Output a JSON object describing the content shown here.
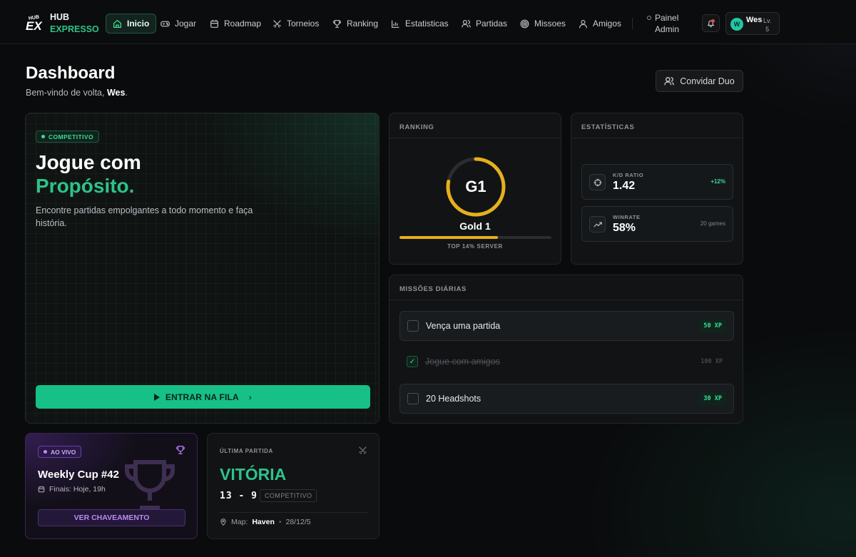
{
  "brand": {
    "line1": "HUB",
    "line2": "EXPRESSO",
    "logo_text": "EX"
  },
  "nav": {
    "items": [
      {
        "label": "Inicio",
        "icon": "home-icon",
        "active": true
      },
      {
        "label": "Jogar",
        "icon": "gamepad-icon"
      },
      {
        "label": "Roadmap",
        "icon": "calendar-icon"
      },
      {
        "label": "Torneios",
        "icon": "swords-icon"
      },
      {
        "label": "Ranking",
        "icon": "trophy-icon"
      },
      {
        "label": "Estatisticas",
        "icon": "bar-chart-icon"
      },
      {
        "label": "Partidas",
        "icon": "users-icon"
      },
      {
        "label": "Missoes",
        "icon": "target-icon"
      },
      {
        "label": "Amigos",
        "icon": "user-icon"
      }
    ],
    "admin_line1": "Painel",
    "admin_line2": "Admin"
  },
  "user": {
    "avatar_initial": "W",
    "name": "Wes",
    "level_label": "Lv.",
    "level": "5"
  },
  "header": {
    "title": "Dashboard",
    "welcome_prefix": "Bem-vindo de volta,",
    "welcome_name": "Wes",
    "welcome_suffix": ".",
    "invite_button": "Convidar Duo"
  },
  "hero": {
    "badge": "COMPETITIVO",
    "title_line1": "Jogue com",
    "title_line2": "Propósito.",
    "description": "Encontre partidas empolgantes a todo momento e faça história.",
    "queue_button": "ENTRAR NA FILA"
  },
  "ranking": {
    "header": "RANKING",
    "rank_code": "G1",
    "rank_name": "Gold 1",
    "progress": 0.65,
    "ring_progress": 0.78,
    "top_text": "TOP 14% SERVER",
    "accent": "#e6b01c"
  },
  "stats": {
    "header": "ESTATÍSTICAS",
    "kd": {
      "label": "K/D RATIO",
      "value": "1.42",
      "change": "+12%"
    },
    "winrate": {
      "label": "WINRATE",
      "value": "58%",
      "games": "20 games"
    }
  },
  "missions": {
    "header": "MISSÕES DIÁRIAS",
    "items": [
      {
        "title": "Vença uma partida",
        "xp": "50 XP",
        "done": false
      },
      {
        "title": "Jogue com amigos",
        "xp": "100 XP",
        "done": true
      },
      {
        "title": "20 Headshots",
        "xp": "30 XP",
        "done": false
      }
    ]
  },
  "tournament": {
    "badge": "AO VIVO",
    "title": "Weekly Cup #42",
    "finals": "Finais: Hoje, 19h",
    "button": "VER CHAVEAMENTO"
  },
  "last_match": {
    "header": "ÚLTIMA PARTIDA",
    "result": "VITÓRIA",
    "score": "13 - 9",
    "mode": "COMPETITIVO",
    "map_label": "Map:",
    "map_name": "Haven",
    "date": "28/12/5"
  },
  "colors": {
    "accent_green": "#2ec28a",
    "button_green": "#17c086",
    "purple": "#a46ee8",
    "gold": "#e6b01c"
  }
}
